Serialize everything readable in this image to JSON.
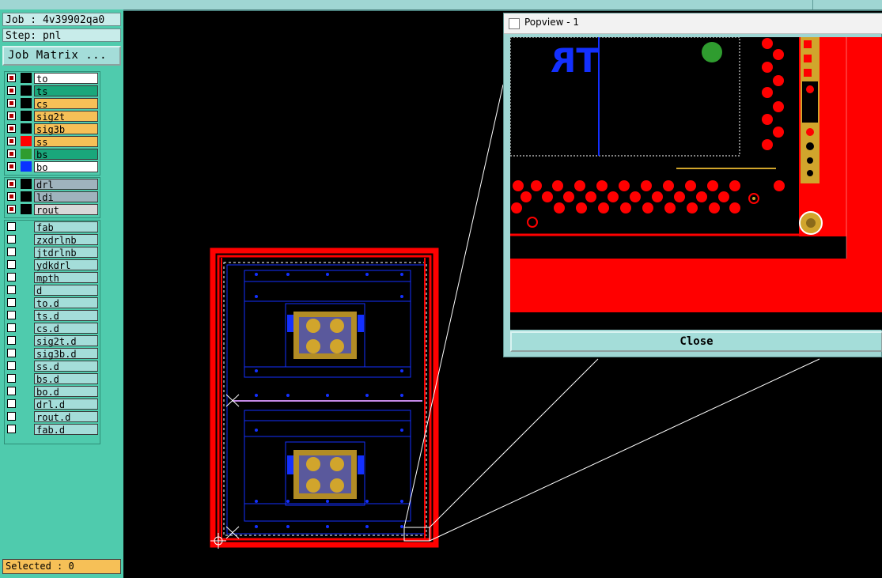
{
  "header": {
    "job": "Job : 4v39902qa0",
    "step": "Step: pnl",
    "job_matrix_label": "Job Matrix ..."
  },
  "layers": {
    "board": [
      {
        "name": "to",
        "fill": "#ffffff",
        "swatch": "#000000",
        "marker": "red"
      },
      {
        "name": "ts",
        "fill": "#1aa77b",
        "swatch": "#000000",
        "marker": "red"
      },
      {
        "name": "cs",
        "fill": "#f6c057",
        "swatch": "#000000",
        "marker": "red"
      },
      {
        "name": "sig2t",
        "fill": "#f6c057",
        "swatch": "#000000",
        "marker": "red"
      },
      {
        "name": "sig3b",
        "fill": "#f6c057",
        "swatch": "#000000",
        "marker": "red"
      },
      {
        "name": "ss",
        "fill": "#f6c057",
        "swatch": "#ff0000",
        "marker": "red"
      },
      {
        "name": "bs",
        "fill": "#1aa77b",
        "swatch": "#2f9c2f",
        "marker": "red"
      },
      {
        "name": "bo",
        "fill": "#ffffff",
        "swatch": "#0a33ff",
        "marker": "red"
      }
    ],
    "drill": [
      {
        "name": "drl",
        "fill": "#9fb3bd",
        "swatch": "#000000",
        "marker": "red"
      },
      {
        "name": "ldi",
        "fill": "#9fb3bd",
        "swatch": "#000000",
        "marker": "red"
      },
      {
        "name": "rout",
        "fill": "#d8d8d8",
        "swatch": "#000000",
        "marker": "red"
      }
    ],
    "misc": [
      {
        "name": "fab"
      },
      {
        "name": "zxdrlnb"
      },
      {
        "name": "jtdrlnb"
      },
      {
        "name": "ydkdrl"
      },
      {
        "name": "mpth"
      },
      {
        "name": "d"
      },
      {
        "name": "to.d"
      },
      {
        "name": "ts.d"
      },
      {
        "name": "cs.d"
      },
      {
        "name": "sig2t.d"
      },
      {
        "name": "sig3b.d"
      },
      {
        "name": "ss.d"
      },
      {
        "name": "bs.d"
      },
      {
        "name": "bo.d"
      },
      {
        "name": "drl.d"
      },
      {
        "name": "rout.d"
      },
      {
        "name": "fab.d"
      }
    ]
  },
  "status": {
    "selected": "Selected : 0"
  },
  "popview": {
    "title": "Popview - 1",
    "close_label": "Close",
    "zoom_text": "TR"
  },
  "colors": {
    "panel": "#4fcbad",
    "board_red": "#ff0000",
    "pad_gold": "#d1a52c",
    "trace_blue": "#1330ff",
    "pad_green": "#2f9c2f"
  }
}
